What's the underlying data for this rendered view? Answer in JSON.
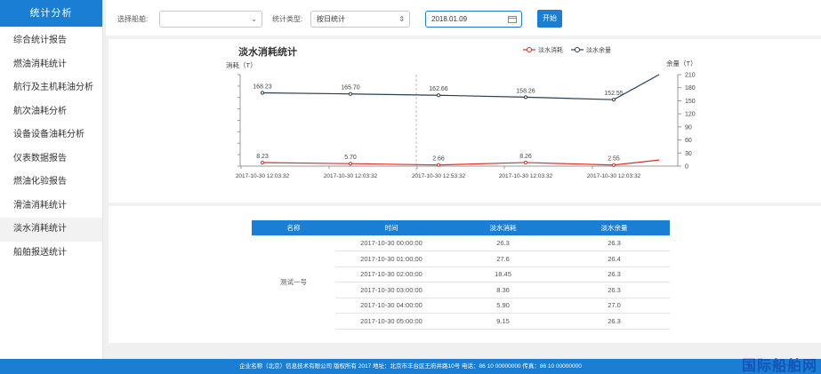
{
  "sidebar": {
    "title": "统计分析",
    "items": [
      "综合统计报告",
      "燃油消耗统计",
      "航行及主机耗油分析",
      "航次油耗分析",
      "设备设备油耗分析",
      "仪表数据报告",
      "燃油化验报告",
      "滑油消耗统计",
      "淡水消耗统计",
      "船舶报送统计"
    ]
  },
  "toolbar": {
    "ship_label": "选择船舶:",
    "ship_value": "",
    "type_label": "统计类型:",
    "type_value": "按日统计",
    "date_value": "2018.01.09",
    "submit_label": "开始"
  },
  "chart_data": {
    "type": "line",
    "title": "淡水消耗统计",
    "ylabel_left": "消耗（T）",
    "ylabel_right": "余量（T）",
    "x": [
      "2017-10-30 12:03:32",
      "2017-10-30 12:03:32",
      "2017-10-30 12:53:32",
      "2017-10-30 12:03:32",
      "2017-10-30 12:03:32"
    ],
    "right_axis_ticks": [
      0,
      30,
      60,
      90,
      120,
      150,
      180,
      210
    ],
    "right_ylim": [
      0,
      210
    ],
    "legend_position": "top-right",
    "series": [
      {
        "name": "淡水消耗",
        "color": "#d9302c",
        "values": [
          8.23,
          5.7,
          2.66,
          8.26,
          2.55,
          14
        ],
        "labels": [
          "8.23",
          "5.70",
          "2.66",
          "8.26",
          "2.55",
          ""
        ]
      },
      {
        "name": "淡水余量",
        "color": "#2b3e50",
        "values": [
          168.23,
          165.7,
          162.66,
          158.26,
          152.55,
          210
        ],
        "labels": [
          "168.23",
          "165.70",
          "162.66",
          "158.26",
          "152.55",
          ""
        ]
      }
    ]
  },
  "table": {
    "headers": [
      "名称",
      "时间",
      "淡水消耗",
      "淡水余量"
    ],
    "ship_name": "测试一号",
    "rows": [
      [
        "2017-10-30 00:00:00",
        "26.3",
        "26.3"
      ],
      [
        "2017-10-30 01:00:00",
        "27.6",
        "26.4"
      ],
      [
        "2017-10-30 02:00:00",
        "18.45",
        "26.3"
      ],
      [
        "2017-10-30 03:00:00",
        "8.36",
        "26.3"
      ],
      [
        "2017-10-30 04:00:00",
        "5.90",
        "27.0"
      ],
      [
        "2017-10-30 05:00:00",
        "9.15",
        "26.3"
      ]
    ]
  },
  "footer": {
    "text": "企业名称（北京）信息技术有限公司 版权所有 2017 地址：北京市丰台区王府井路10号 电话：86 10 00000000 传真：86 10 00000000"
  },
  "watermark": "国际船舶网"
}
